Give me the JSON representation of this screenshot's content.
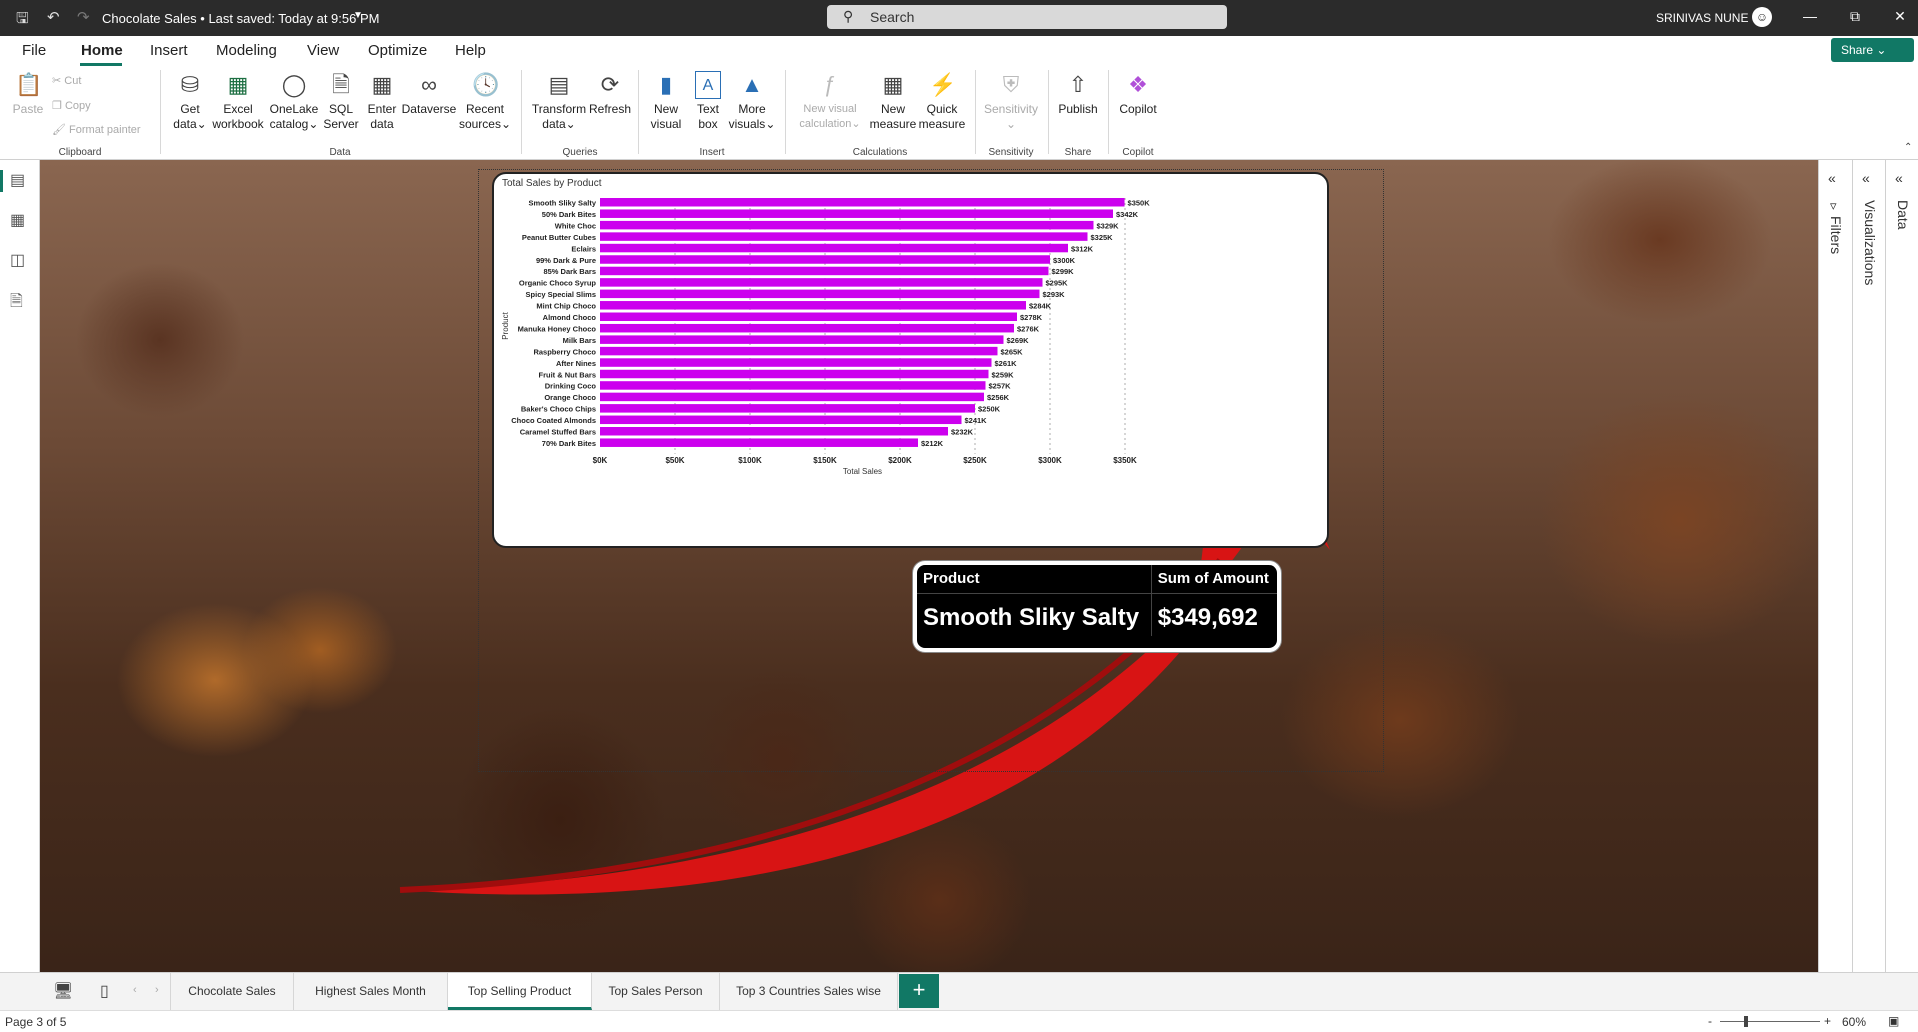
{
  "titlebar": {
    "title": "Chocolate Sales • Last saved: Today at 9:56 PM",
    "search_placeholder": "Search",
    "user": "SRINIVAS NUNE"
  },
  "menu": {
    "items": [
      "File",
      "Home",
      "Insert",
      "Modeling",
      "View",
      "Optimize",
      "Help"
    ],
    "active": "Home",
    "share": "Share"
  },
  "ribbon": {
    "clipboard": {
      "paste": "Paste",
      "cut": "Cut",
      "copy": "Copy",
      "format_painter": "Format painter",
      "group": "Clipboard"
    },
    "data": {
      "get_data": [
        "Get",
        "data"
      ],
      "excel": [
        "Excel",
        "workbook"
      ],
      "onelake": [
        "OneLake",
        "catalog"
      ],
      "sql": [
        "SQL",
        "Server"
      ],
      "enter": [
        "Enter",
        "data"
      ],
      "dataverse": [
        "Dataverse",
        ""
      ],
      "recent": [
        "Recent",
        "sources"
      ],
      "group": "Data"
    },
    "queries": {
      "transform": [
        "Transform",
        "data"
      ],
      "refresh": [
        "Refresh",
        ""
      ],
      "group": "Queries"
    },
    "insert": {
      "new_visual": [
        "New",
        "visual"
      ],
      "text_box": [
        "Text",
        "box"
      ],
      "more_visuals": [
        "More",
        "visuals"
      ],
      "group": "Insert"
    },
    "calculations": {
      "new_visual_calc": [
        "New visual",
        "calculation"
      ],
      "new_measure": [
        "New",
        "measure"
      ],
      "quick_measure": [
        "Quick",
        "measure"
      ],
      "group": "Calculations"
    },
    "sensitivity": {
      "label": [
        "Sensitivity",
        ""
      ],
      "group": "Sensitivity"
    },
    "share": {
      "publish": [
        "Publish",
        ""
      ],
      "group": "Share"
    },
    "copilot": {
      "label": [
        "Copilot",
        ""
      ],
      "group": "Copilot"
    }
  },
  "right_panes": {
    "filters": "Filters",
    "visualizations": "Visualizations",
    "data": "Data"
  },
  "tabs": {
    "pages": [
      "Chocolate Sales",
      "Highest Sales Month",
      "Top Selling Product",
      "Top Sales Person",
      "Top 3 Countries Sales wise"
    ],
    "active": "Top Selling Product"
  },
  "status": {
    "page": "Page 3 of 5",
    "zoom": "60%"
  },
  "table_visual": {
    "headers": [
      "Product",
      "Sum of Amount"
    ],
    "row": [
      "Smooth Sliky Salty",
      "$349,692"
    ]
  },
  "colors": {
    "accent": "#117865",
    "bar": "#cc00ee",
    "arrow": "#d81414"
  },
  "chart_data": {
    "type": "bar",
    "orientation": "horizontal",
    "title": "Total Sales by Product",
    "xlabel": "Total Sales",
    "ylabel": "Product",
    "xlim": [
      0,
      350000
    ],
    "x_ticks": [
      "$0K",
      "$50K",
      "$100K",
      "$150K",
      "$200K",
      "$250K",
      "$300K",
      "$350K"
    ],
    "grid": true,
    "categories": [
      "Smooth Sliky Salty",
      "50% Dark Bites",
      "White Choc",
      "Peanut Butter Cubes",
      "Eclairs",
      "99% Dark & Pure",
      "85% Dark Bars",
      "Organic Choco Syrup",
      "Spicy Special Slims",
      "Mint Chip Choco",
      "Almond Choco",
      "Manuka Honey Choco",
      "Milk Bars",
      "Raspberry Choco",
      "After Nines",
      "Fruit & Nut Bars",
      "Drinking Coco",
      "Orange Choco",
      "Baker's Choco Chips",
      "Choco Coated Almonds",
      "Caramel Stuffed Bars",
      "70% Dark Bites"
    ],
    "values": [
      349692,
      342000,
      329000,
      325000,
      312000,
      300000,
      299000,
      295000,
      293000,
      284000,
      278000,
      276000,
      269000,
      265000,
      261000,
      259000,
      257000,
      256000,
      250000,
      241000,
      232000,
      212000
    ],
    "data_labels": [
      "$350K",
      "$342K",
      "$329K",
      "$325K",
      "$312K",
      "$300K",
      "$299K",
      "$295K",
      "$293K",
      "$284K",
      "$278K",
      "$276K",
      "$269K",
      "$265K",
      "$261K",
      "$259K",
      "$257K",
      "$256K",
      "$250K",
      "$241K",
      "$232K",
      "$212K"
    ]
  }
}
